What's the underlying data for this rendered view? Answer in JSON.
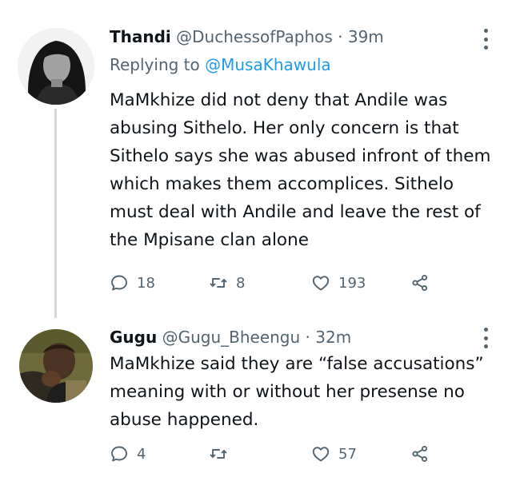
{
  "tweets": [
    {
      "display_name": "Thandi",
      "handle": "@DuchessofPaphos",
      "separator": "·",
      "time": "39m",
      "replying_prefix": "Replying to",
      "replying_handle": "@MusaKhawula",
      "text": "MaMkhize did not deny that Andile was abusing Sithelo. Her only concern is that Sithelo says she was abused infront of them which makes them accomplices. Sithelo must deal with Andile and leave the rest of the Mpisane clan alone",
      "replies": "18",
      "retweets": "8",
      "likes": "193"
    },
    {
      "display_name": "Gugu",
      "handle": "@Gugu_Bheengu",
      "separator": "·",
      "time": "32m",
      "text": "MaMkhize said they are “false accusations” meaning with or without her presense no abuse happened.",
      "replies": "4",
      "retweets": "",
      "likes": "57"
    }
  ],
  "icons": {
    "reply": "comment-bubble-icon",
    "retweet": "retweet-arrows-icon",
    "like": "heart-icon",
    "share": "share-nodes-icon",
    "more": "more-vertical-icon"
  },
  "colors": {
    "text": "#0f1419",
    "secondary": "#536471",
    "link": "#1d9bf0",
    "thread_line": "#cfd9de"
  }
}
